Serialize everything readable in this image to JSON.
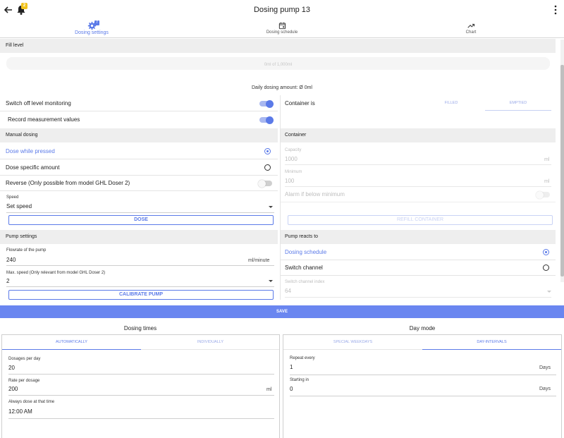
{
  "header": {
    "title": "Dosing pump 13",
    "notification_count": "2"
  },
  "tabs": [
    {
      "label": "Dosing settings",
      "badge": "7",
      "active": true
    },
    {
      "label": "Dosing schedule",
      "active": false
    },
    {
      "label": "Chart",
      "active": false
    }
  ],
  "fill_level": {
    "heading": "Fill level",
    "bar_text": "0ml of 1,000ml",
    "fill_fraction": 0,
    "daily_amount": "Daily dosing amount: Ø 0ml"
  },
  "left": {
    "switch_off_level": "Switch off level monitoring",
    "record_values": "Record measurement values",
    "manual_dosing": {
      "heading": "Manual dosing",
      "dose_while_pressed": "Dose while pressed",
      "dose_specific_amount": "Dose specific amount",
      "reverse": "Reverse (Only possible from model GHL Doser 2)",
      "speed_label": "Speed",
      "speed_value": "Set speed",
      "dose_button": "DOSE"
    },
    "pump_settings": {
      "heading": "Pump settings",
      "flowrate_label": "Flowrate of the pump",
      "flowrate_value": "240",
      "flowrate_unit": "ml/minute",
      "max_speed_label": "Max. speed (Only relevant from model GHL Doser 2)",
      "max_speed_value": "2",
      "calibrate_button": "CALIBRATE PUMP"
    }
  },
  "right": {
    "container_is": {
      "label": "Container is",
      "options": [
        "FILLED",
        "EMPTIED"
      ],
      "selected": "EMPTIED"
    },
    "container": {
      "heading": "Container",
      "capacity_label": "Capacity",
      "capacity_value": "1000",
      "capacity_unit": "ml",
      "minimum_label": "Minimum",
      "minimum_value": "100",
      "minimum_unit": "ml",
      "alarm_label": "Alarm if below minimum",
      "refill_button": "REFILL CONTAINER"
    },
    "pump_reacts": {
      "heading": "Pump reacts to",
      "dosing_schedule": "Dosing schedule",
      "switch_channel": "Switch channel",
      "switch_index_label": "Switch channel index",
      "switch_index_value": "64"
    }
  },
  "save_button": "SAVE",
  "dosing_times": {
    "title": "Dosing times",
    "tabs": [
      "AUTOMATICALLY",
      "INDIVIDUALLY"
    ],
    "dosages_label": "Dosages per day",
    "dosages_value": "20",
    "rate_label": "Rate per dosage",
    "rate_value": "200",
    "rate_unit": "ml",
    "always_label": "Always dose at that time",
    "always_value": "12:00 AM"
  },
  "day_mode": {
    "title": "Day mode",
    "tabs": [
      "SPECIAL WEEKDAYS",
      "DAY-INTERVALS"
    ],
    "repeat_label": "Repeat every",
    "repeat_value": "1",
    "repeat_unit": "Days",
    "starting_label": "Starting in",
    "starting_value": "0",
    "starting_unit": "Days"
  },
  "colors": {
    "accent": "#5b7ae8",
    "save_bar": "#6a86f0",
    "badge_yellow": "#f2c31c"
  }
}
